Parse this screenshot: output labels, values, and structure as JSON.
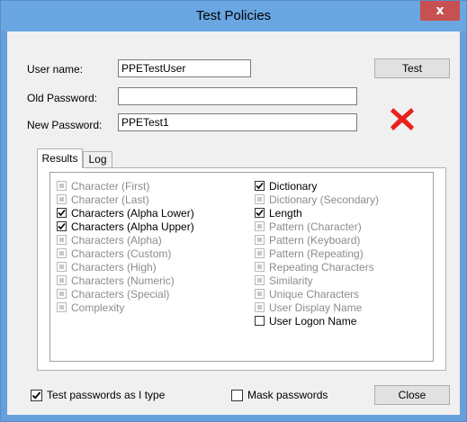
{
  "window": {
    "title": "Test Policies",
    "close_glyph": "x"
  },
  "form": {
    "username_label": "User name:",
    "username_value": "PPETestUser",
    "old_password_label": "Old Password:",
    "old_password_value": "",
    "new_password_label": "New Password:",
    "new_password_value": "PPETest1"
  },
  "buttons": {
    "test": "Test",
    "close": "Close"
  },
  "status": {
    "result_icon": "red-x-icon",
    "result_color": "#e8211b"
  },
  "tabs": [
    {
      "label": "Results",
      "active": true
    },
    {
      "label": "Log",
      "active": false
    }
  ],
  "results": {
    "left": [
      {
        "label": "Character (First)",
        "state": "indeterminate"
      },
      {
        "label": "Character (Last)",
        "state": "indeterminate"
      },
      {
        "label": "Characters (Alpha Lower)",
        "state": "checked"
      },
      {
        "label": "Characters (Alpha Upper)",
        "state": "checked"
      },
      {
        "label": "Characters (Alpha)",
        "state": "indeterminate"
      },
      {
        "label": "Characters (Custom)",
        "state": "indeterminate"
      },
      {
        "label": "Characters (High)",
        "state": "indeterminate"
      },
      {
        "label": "Characters (Numeric)",
        "state": "indeterminate"
      },
      {
        "label": "Characters (Special)",
        "state": "indeterminate"
      },
      {
        "label": "Complexity",
        "state": "indeterminate"
      }
    ],
    "right": [
      {
        "label": "Dictionary",
        "state": "checked"
      },
      {
        "label": "Dictionary (Secondary)",
        "state": "indeterminate"
      },
      {
        "label": "Length",
        "state": "checked"
      },
      {
        "label": "Pattern (Character)",
        "state": "indeterminate"
      },
      {
        "label": "Pattern (Keyboard)",
        "state": "indeterminate"
      },
      {
        "label": "Pattern (Repeating)",
        "state": "indeterminate"
      },
      {
        "label": "Repeating Characters",
        "state": "indeterminate"
      },
      {
        "label": "Similarity",
        "state": "indeterminate"
      },
      {
        "label": "Unique Characters",
        "state": "indeterminate"
      },
      {
        "label": "User Display Name",
        "state": "indeterminate"
      },
      {
        "label": "User Logon Name",
        "state": "unchecked"
      }
    ]
  },
  "options": {
    "test_as_type_label": "Test passwords as I type",
    "test_as_type_checked": true,
    "mask_label": "Mask passwords",
    "mask_checked": false
  }
}
